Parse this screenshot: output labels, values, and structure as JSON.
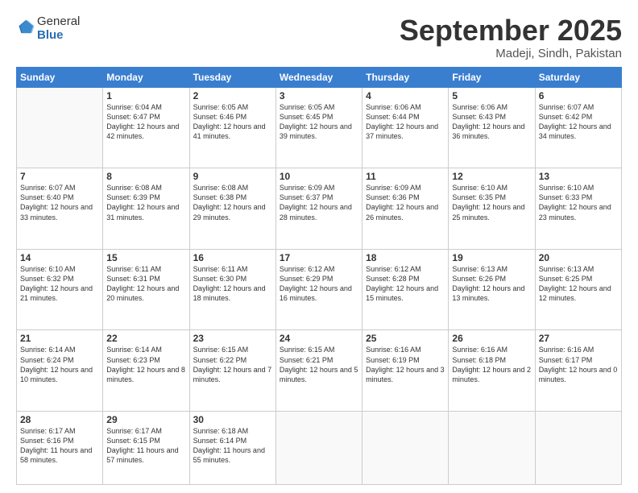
{
  "logo": {
    "general": "General",
    "blue": "Blue"
  },
  "header": {
    "month": "September 2025",
    "location": "Madeji, Sindh, Pakistan"
  },
  "days_of_week": [
    "Sunday",
    "Monday",
    "Tuesday",
    "Wednesday",
    "Thursday",
    "Friday",
    "Saturday"
  ],
  "weeks": [
    [
      {
        "num": "",
        "sunrise": "",
        "sunset": "",
        "daylight": ""
      },
      {
        "num": "1",
        "sunrise": "Sunrise: 6:04 AM",
        "sunset": "Sunset: 6:47 PM",
        "daylight": "Daylight: 12 hours and 42 minutes."
      },
      {
        "num": "2",
        "sunrise": "Sunrise: 6:05 AM",
        "sunset": "Sunset: 6:46 PM",
        "daylight": "Daylight: 12 hours and 41 minutes."
      },
      {
        "num": "3",
        "sunrise": "Sunrise: 6:05 AM",
        "sunset": "Sunset: 6:45 PM",
        "daylight": "Daylight: 12 hours and 39 minutes."
      },
      {
        "num": "4",
        "sunrise": "Sunrise: 6:06 AM",
        "sunset": "Sunset: 6:44 PM",
        "daylight": "Daylight: 12 hours and 37 minutes."
      },
      {
        "num": "5",
        "sunrise": "Sunrise: 6:06 AM",
        "sunset": "Sunset: 6:43 PM",
        "daylight": "Daylight: 12 hours and 36 minutes."
      },
      {
        "num": "6",
        "sunrise": "Sunrise: 6:07 AM",
        "sunset": "Sunset: 6:42 PM",
        "daylight": "Daylight: 12 hours and 34 minutes."
      }
    ],
    [
      {
        "num": "7",
        "sunrise": "Sunrise: 6:07 AM",
        "sunset": "Sunset: 6:40 PM",
        "daylight": "Daylight: 12 hours and 33 minutes."
      },
      {
        "num": "8",
        "sunrise": "Sunrise: 6:08 AM",
        "sunset": "Sunset: 6:39 PM",
        "daylight": "Daylight: 12 hours and 31 minutes."
      },
      {
        "num": "9",
        "sunrise": "Sunrise: 6:08 AM",
        "sunset": "Sunset: 6:38 PM",
        "daylight": "Daylight: 12 hours and 29 minutes."
      },
      {
        "num": "10",
        "sunrise": "Sunrise: 6:09 AM",
        "sunset": "Sunset: 6:37 PM",
        "daylight": "Daylight: 12 hours and 28 minutes."
      },
      {
        "num": "11",
        "sunrise": "Sunrise: 6:09 AM",
        "sunset": "Sunset: 6:36 PM",
        "daylight": "Daylight: 12 hours and 26 minutes."
      },
      {
        "num": "12",
        "sunrise": "Sunrise: 6:10 AM",
        "sunset": "Sunset: 6:35 PM",
        "daylight": "Daylight: 12 hours and 25 minutes."
      },
      {
        "num": "13",
        "sunrise": "Sunrise: 6:10 AM",
        "sunset": "Sunset: 6:33 PM",
        "daylight": "Daylight: 12 hours and 23 minutes."
      }
    ],
    [
      {
        "num": "14",
        "sunrise": "Sunrise: 6:10 AM",
        "sunset": "Sunset: 6:32 PM",
        "daylight": "Daylight: 12 hours and 21 minutes."
      },
      {
        "num": "15",
        "sunrise": "Sunrise: 6:11 AM",
        "sunset": "Sunset: 6:31 PM",
        "daylight": "Daylight: 12 hours and 20 minutes."
      },
      {
        "num": "16",
        "sunrise": "Sunrise: 6:11 AM",
        "sunset": "Sunset: 6:30 PM",
        "daylight": "Daylight: 12 hours and 18 minutes."
      },
      {
        "num": "17",
        "sunrise": "Sunrise: 6:12 AM",
        "sunset": "Sunset: 6:29 PM",
        "daylight": "Daylight: 12 hours and 16 minutes."
      },
      {
        "num": "18",
        "sunrise": "Sunrise: 6:12 AM",
        "sunset": "Sunset: 6:28 PM",
        "daylight": "Daylight: 12 hours and 15 minutes."
      },
      {
        "num": "19",
        "sunrise": "Sunrise: 6:13 AM",
        "sunset": "Sunset: 6:26 PM",
        "daylight": "Daylight: 12 hours and 13 minutes."
      },
      {
        "num": "20",
        "sunrise": "Sunrise: 6:13 AM",
        "sunset": "Sunset: 6:25 PM",
        "daylight": "Daylight: 12 hours and 12 minutes."
      }
    ],
    [
      {
        "num": "21",
        "sunrise": "Sunrise: 6:14 AM",
        "sunset": "Sunset: 6:24 PM",
        "daylight": "Daylight: 12 hours and 10 minutes."
      },
      {
        "num": "22",
        "sunrise": "Sunrise: 6:14 AM",
        "sunset": "Sunset: 6:23 PM",
        "daylight": "Daylight: 12 hours and 8 minutes."
      },
      {
        "num": "23",
        "sunrise": "Sunrise: 6:15 AM",
        "sunset": "Sunset: 6:22 PM",
        "daylight": "Daylight: 12 hours and 7 minutes."
      },
      {
        "num": "24",
        "sunrise": "Sunrise: 6:15 AM",
        "sunset": "Sunset: 6:21 PM",
        "daylight": "Daylight: 12 hours and 5 minutes."
      },
      {
        "num": "25",
        "sunrise": "Sunrise: 6:16 AM",
        "sunset": "Sunset: 6:19 PM",
        "daylight": "Daylight: 12 hours and 3 minutes."
      },
      {
        "num": "26",
        "sunrise": "Sunrise: 6:16 AM",
        "sunset": "Sunset: 6:18 PM",
        "daylight": "Daylight: 12 hours and 2 minutes."
      },
      {
        "num": "27",
        "sunrise": "Sunrise: 6:16 AM",
        "sunset": "Sunset: 6:17 PM",
        "daylight": "Daylight: 12 hours and 0 minutes."
      }
    ],
    [
      {
        "num": "28",
        "sunrise": "Sunrise: 6:17 AM",
        "sunset": "Sunset: 6:16 PM",
        "daylight": "Daylight: 11 hours and 58 minutes."
      },
      {
        "num": "29",
        "sunrise": "Sunrise: 6:17 AM",
        "sunset": "Sunset: 6:15 PM",
        "daylight": "Daylight: 11 hours and 57 minutes."
      },
      {
        "num": "30",
        "sunrise": "Sunrise: 6:18 AM",
        "sunset": "Sunset: 6:14 PM",
        "daylight": "Daylight: 11 hours and 55 minutes."
      },
      {
        "num": "",
        "sunrise": "",
        "sunset": "",
        "daylight": ""
      },
      {
        "num": "",
        "sunrise": "",
        "sunset": "",
        "daylight": ""
      },
      {
        "num": "",
        "sunrise": "",
        "sunset": "",
        "daylight": ""
      },
      {
        "num": "",
        "sunrise": "",
        "sunset": "",
        "daylight": ""
      }
    ]
  ]
}
